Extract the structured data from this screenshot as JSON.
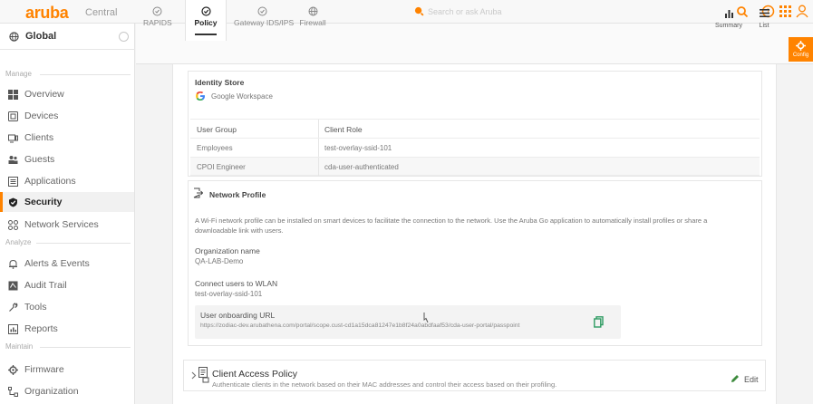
{
  "topbar": {
    "logo": "aruba",
    "logo_sub": "Central",
    "search_placeholder": "Search or ask Aruba"
  },
  "sidebar": {
    "global_label": "Global",
    "sections": {
      "manage": "Manage",
      "analyze": "Analyze",
      "maintain": "Maintain"
    },
    "items": [
      {
        "label": "Overview",
        "icon": "overview-icon"
      },
      {
        "label": "Devices",
        "icon": "devices-icon"
      },
      {
        "label": "Clients",
        "icon": "clients-icon"
      },
      {
        "label": "Guests",
        "icon": "guests-icon"
      },
      {
        "label": "Applications",
        "icon": "applications-icon"
      },
      {
        "label": "Security",
        "icon": "shield-icon",
        "active": true
      },
      {
        "label": "Network Services",
        "icon": "network-services-icon"
      },
      {
        "label": "Alerts & Events",
        "icon": "bell-icon"
      },
      {
        "label": "Audit Trail",
        "icon": "audit-trail-icon"
      },
      {
        "label": "Tools",
        "icon": "tools-icon"
      },
      {
        "label": "Reports",
        "icon": "reports-icon"
      },
      {
        "label": "Firmware",
        "icon": "firmware-icon"
      },
      {
        "label": "Organization",
        "icon": "organization-icon"
      }
    ]
  },
  "tabs": [
    {
      "label": "RAPIDS"
    },
    {
      "label": "Policy",
      "active": true
    },
    {
      "label": "Gateway IDS/IPS"
    },
    {
      "label": "Firewall"
    }
  ],
  "right_tools": {
    "summary": "Summary",
    "list": "List",
    "config": "Config"
  },
  "identity_store": {
    "title": "Identity Store",
    "provider": "Google Workspace",
    "columns": [
      "User Group",
      "Client Role"
    ],
    "rows": [
      [
        "Employees",
        "test-overlay-ssid-101"
      ],
      [
        "CPOI Engineer",
        "cda-user-authenticated"
      ]
    ]
  },
  "network_profile": {
    "title": "Network Profile",
    "description_line1": "A Wi-Fi network profile can be installed on smart devices to facilitate the connection to the network. Use the Aruba Go application to automatically install profiles or share a",
    "description_line2": "downloadable link with users.",
    "org_label": "Organization name",
    "org_value": "QA-LAB-Demo",
    "wlan_label": "Connect users to WLAN",
    "wlan_value": "test-overlay-ssid-101",
    "url_label": "User onboarding URL",
    "url_value": "https://zodiac-dev.arubathena.com/portal/scope.cust-cd1a15dca81247e1b8f24a0abdfaaf53/cda-user-portal/passpoint"
  },
  "client_access_policy": {
    "title": "Client Access Policy",
    "description": "Authenticate clients in the network based on their MAC addresses and control their access based on their profiling.",
    "edit_label": "Edit"
  },
  "colors": {
    "accent": "#ff8300",
    "google_blue": "#4285f4",
    "edit_green": "#3d8b3d",
    "copy_green": "#2e9b62"
  }
}
